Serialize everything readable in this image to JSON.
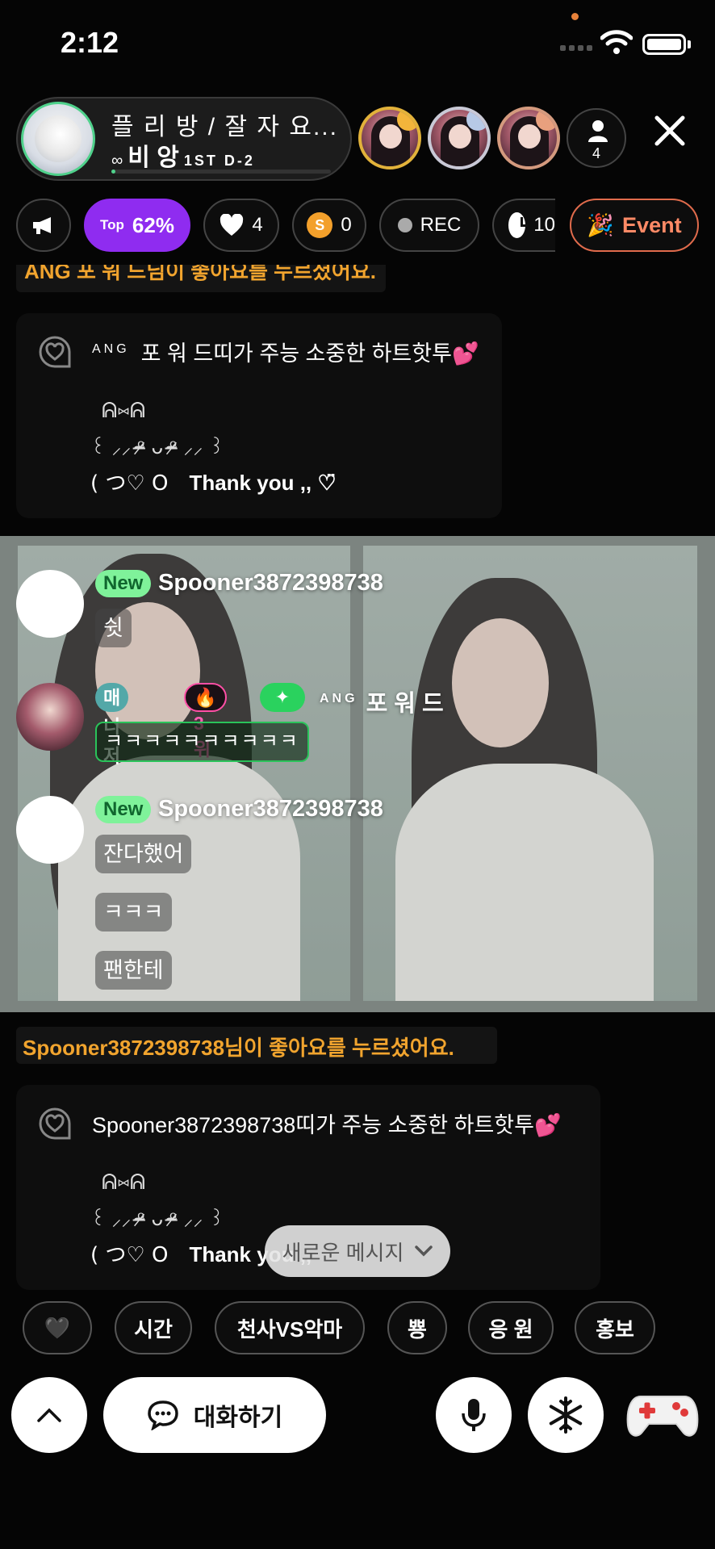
{
  "status_bar": {
    "time": "2:12"
  },
  "room": {
    "title": "플 리 방 / 잘 자 요...",
    "host_prefix": "∞",
    "host_name": "비 앙",
    "host_suffix": "1ST  D-2",
    "progress": 0.02,
    "listener_count": "4"
  },
  "top_users": [
    {
      "rank": "gold"
    },
    {
      "rank": "silver"
    },
    {
      "rank": "bronze"
    }
  ],
  "info_bar": {
    "top_prefix": "Top",
    "top_value": "62%",
    "likes": "4",
    "spoons": "0",
    "spoon_icon_letter": "S",
    "rec_label": "REC",
    "timer_partial": "10",
    "event_label": "Event"
  },
  "chat": {
    "notice_top": "ANG 포 워 드님이 좋아요를 누르셨어요.",
    "heart_card_1": {
      "sender_prefix": "ANG",
      "text": "포 워 드띠가 주능 소중한 하트핫투💕",
      "art_line1": "ᕱ⑅ᕱ",
      "art_line2": "꒰ ⸝⸝ ᵒ̴̶̷ ᴗ ᵒ̴̶̷ ⸝⸝ ꒱",
      "art_line3_a": "(  つ♡ O",
      "art_line3_b": "Thank you ,, ♡̈"
    },
    "messages": [
      {
        "badge": "New",
        "nick": "Spooner3872398738",
        "lines": [
          "쉿"
        ]
      },
      {
        "badge_manager": "매니저",
        "badge_rank": "🔥3위",
        "badge_spark": "✦",
        "nick_prefix": "ANG",
        "nick": "포 워 드",
        "lines": [
          "ㅋㅋㅋㅋㅋㅋㅋㅋㅋㅋ"
        ]
      },
      {
        "badge": "New",
        "nick": "Spooner3872398738",
        "lines": [
          "잔다했어",
          "ㅋㅋㅋ",
          "팬한테"
        ]
      }
    ],
    "notice_bottom": "Spooner3872398738님이 좋아요를 누르셨어요.",
    "heart_card_2": {
      "text": "Spooner3872398738띠가 주능 소중한 하트핫투💕",
      "art_line1": "ᕱ⑅ᕱ",
      "art_line2": "꒰ ⸝⸝ ᵒ̴̶̷ ᴗ ᵒ̴̶̷ ⸝⸝ ꒱",
      "art_line3_a": "(  つ♡ O",
      "art_line3_b": "Thank you ,,"
    },
    "new_message_button": "새로운 메시지"
  },
  "quick_chips": [
    "🖤",
    "시간",
    "천사VS악마",
    "뿅",
    "응 원",
    "홍보"
  ],
  "bottom_bar": {
    "talk_label": "대화하기"
  },
  "colors": {
    "accent_purple": "#8f2cf0",
    "notice_orange": "#f1a42e",
    "badge_green": "#7ff29a",
    "event_orange": "#e06b4c"
  }
}
